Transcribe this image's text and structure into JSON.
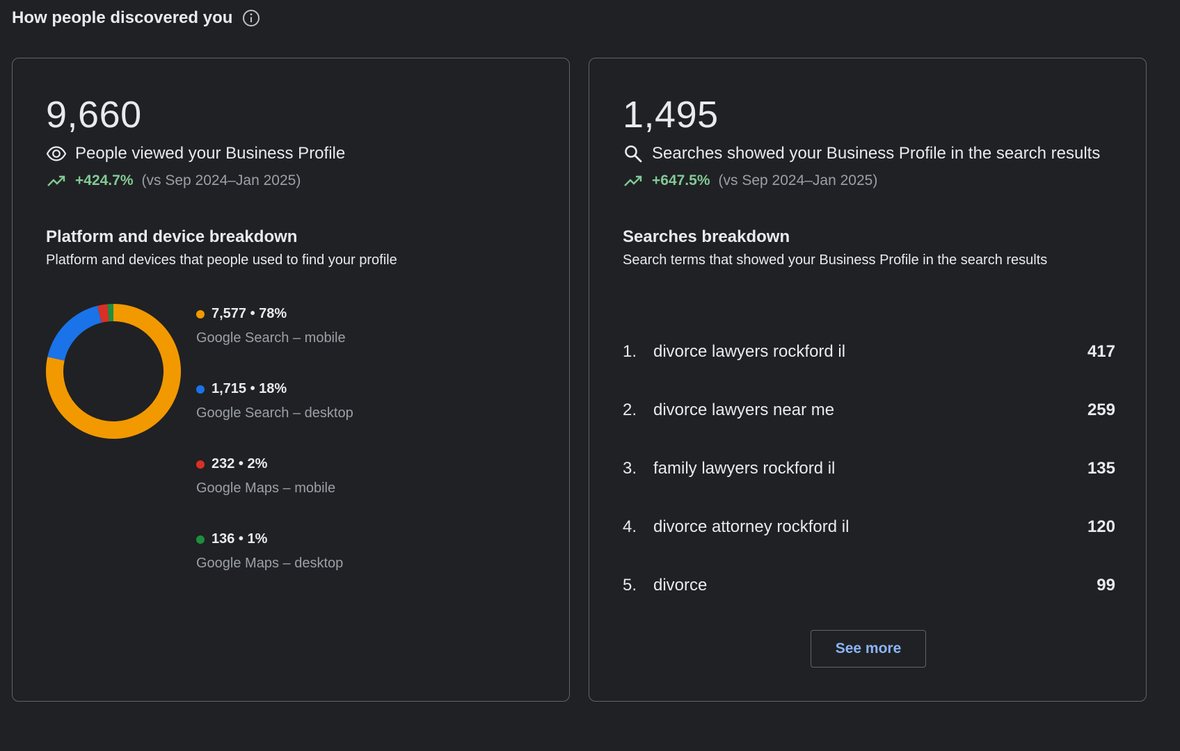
{
  "header": {
    "title": "How people discovered you",
    "info_icon": "info-icon"
  },
  "views_card": {
    "total": "9,660",
    "metric_icon": "eye-icon",
    "metric_label": "People viewed your Business Profile",
    "trend_icon": "trending-up-icon",
    "trend_value": "+424.7%",
    "trend_compare": "(vs Sep 2024–Jan 2025)",
    "breakdown_title": "Platform and device breakdown",
    "breakdown_subtitle": "Platform and devices that people used to find your profile",
    "legend": [
      {
        "value": "7,577 • 78%",
        "label": "Google Search – mobile",
        "color": "#f29900"
      },
      {
        "value": "1,715 • 18%",
        "label": "Google Search – desktop",
        "color": "#1a73e8"
      },
      {
        "value": "232 • 2%",
        "label": "Google Maps – mobile",
        "color": "#d93025"
      },
      {
        "value": "136 • 1%",
        "label": "Google Maps – desktop",
        "color": "#1e8e3e"
      }
    ]
  },
  "chart_data": {
    "type": "pie",
    "categories": [
      "Google Search – mobile",
      "Google Search – desktop",
      "Google Maps – mobile",
      "Google Maps – desktop"
    ],
    "values": [
      7577,
      1715,
      232,
      136
    ],
    "colors": [
      "#f29900",
      "#1a73e8",
      "#d93025",
      "#1e8e3e"
    ],
    "title": "",
    "donut": true
  },
  "searches_card": {
    "total": "1,495",
    "metric_icon": "search-icon",
    "metric_label": "Searches showed your Business Profile in the search results",
    "trend_icon": "trending-up-icon",
    "trend_value": "+647.5%",
    "trend_compare": "(vs Sep 2024–Jan 2025)",
    "breakdown_title": "Searches breakdown",
    "breakdown_subtitle": "Search terms that showed your Business Profile in the search results",
    "items": [
      {
        "rank": "1.",
        "term": "divorce lawyers rockford il",
        "count": "417"
      },
      {
        "rank": "2.",
        "term": "divorce lawyers near me",
        "count": "259"
      },
      {
        "rank": "3.",
        "term": "family lawyers rockford il",
        "count": "135"
      },
      {
        "rank": "4.",
        "term": "divorce attorney rockford il",
        "count": "120"
      },
      {
        "rank": "5.",
        "term": "divorce",
        "count": "99"
      }
    ],
    "see_more_label": "See more"
  }
}
